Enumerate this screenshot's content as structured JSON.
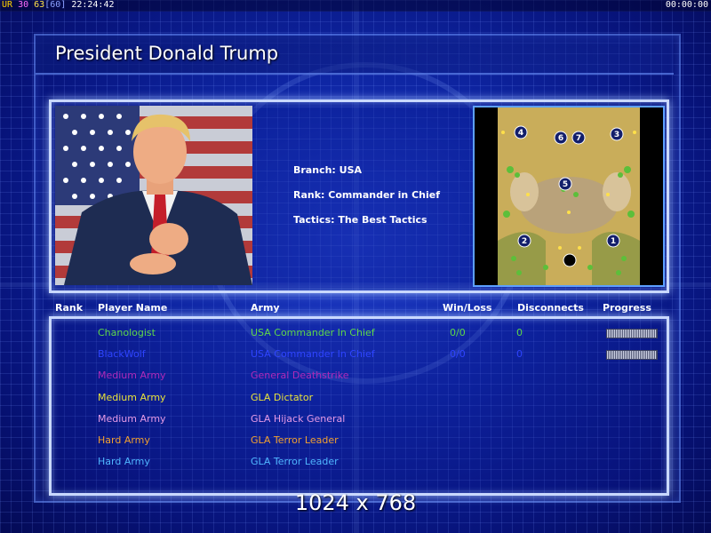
{
  "hud": {
    "ur": "UR",
    "n30": "30",
    "n63": "63",
    "n60": "[60]",
    "clock": "22:24:42",
    "timer": "00:00:00"
  },
  "title": "President Donald Trump",
  "info": {
    "branch": "Branch: USA",
    "rank": "Rank: Commander in Chief",
    "tactics": "Tactics: The Best Tactics"
  },
  "minimap": {
    "markers": [
      "1",
      "2",
      "3",
      "4",
      "5",
      "6",
      "7"
    ]
  },
  "headers": {
    "rank": "Rank",
    "player": "Player Name",
    "army": "Army",
    "winloss": "Win/Loss",
    "disconnects": "Disconnects",
    "progress": "Progress"
  },
  "rows": [
    {
      "player": "Chanologist",
      "army": "USA Commander In Chief",
      "winloss": "0/0",
      "disconnects": "0",
      "color": "#5fd84a",
      "progress": true
    },
    {
      "player": "BlackWolf",
      "army": "USA Commander In Chief",
      "winloss": "0/0",
      "disconnects": "0",
      "color": "#2e44ff",
      "progress": true
    },
    {
      "player": "Medium Army",
      "army": "General Deathstrike",
      "winloss": "",
      "disconnects": "",
      "color": "#b02ab8",
      "progress": false
    },
    {
      "player": "Medium Army",
      "army": "GLA Dictator",
      "winloss": "",
      "disconnects": "",
      "color": "#e8e23a",
      "progress": false
    },
    {
      "player": "Medium Army",
      "army": "GLA Hijack General",
      "winloss": "",
      "disconnects": "",
      "color": "#e69be6",
      "progress": false
    },
    {
      "player": "Hard Army",
      "army": "GLA Terror Leader",
      "winloss": "",
      "disconnects": "",
      "color": "#f0a030",
      "progress": false
    },
    {
      "player": "Hard Army",
      "army": "GLA Terror Leader",
      "winloss": "",
      "disconnects": "",
      "color": "#4fb6ff",
      "progress": false
    }
  ],
  "resolution": "1024 x 768"
}
